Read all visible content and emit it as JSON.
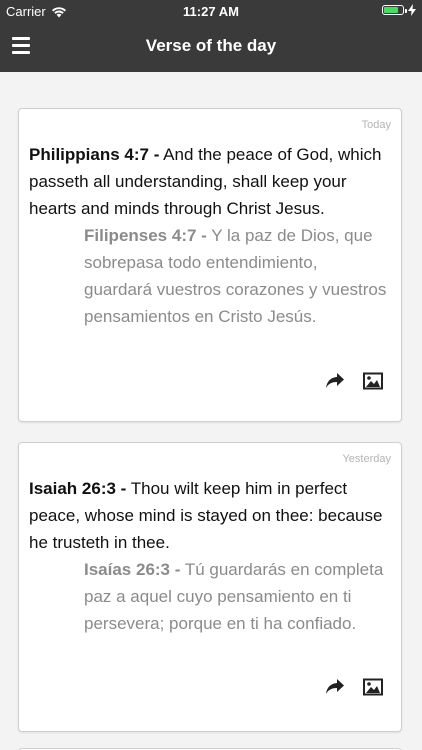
{
  "status_bar": {
    "carrier": "Carrier",
    "time": "11:27 AM",
    "battery_level": 0.8
  },
  "nav": {
    "title": "Verse of the day",
    "menu_icon": "hamburger-menu-icon"
  },
  "cards": [
    {
      "date": "Today",
      "en_ref": "Philippians 4:7 -",
      "en_text": " And the peace of God, which passeth all understanding, shall keep your hearts and minds through Christ Jesus.",
      "es_ref": "Filipenses 4:7 -",
      "es_text": " Y la paz de Dios, que sobrepasa todo entendimiento, guardará vuestros corazones y vuestros pensamientos en Cristo Jesús.",
      "actions": [
        "share-icon",
        "image-icon"
      ]
    },
    {
      "date": "Yesterday",
      "en_ref": "Isaiah 26:3 -",
      "en_text": " Thou wilt keep him in perfect peace, whose mind is stayed on thee: because he trusteth in thee.",
      "es_ref": "Isaías 26:3 -",
      "es_text": " Tú guardarás en completa paz a aquel cuyo pensamiento en ti persevera; porque en ti ha confiado.",
      "actions": [
        "share-icon",
        "image-icon"
      ]
    }
  ]
}
